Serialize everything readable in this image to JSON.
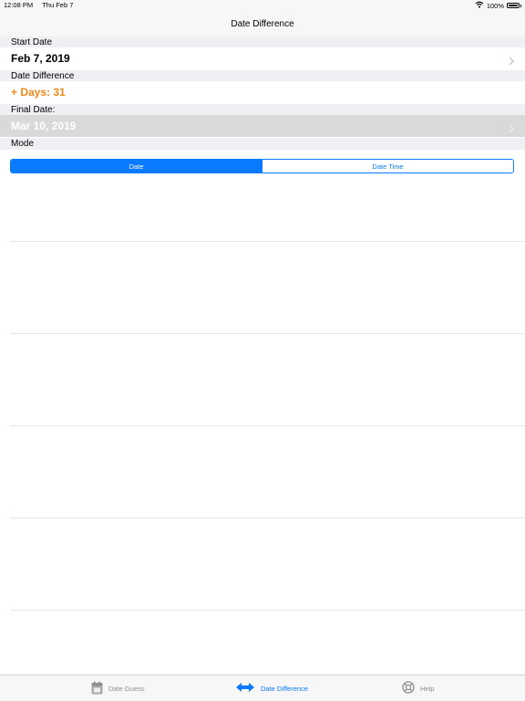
{
  "status_bar": {
    "time": "12:08 PM",
    "date": "Thu Feb 7",
    "battery": "100%",
    "icons": [
      "wifi-icon",
      "battery-icon"
    ]
  },
  "nav": {
    "title": "Date Difference"
  },
  "start": {
    "header": "Start Date",
    "value": "Feb 7, 2019"
  },
  "difference": {
    "header": "Date Difference",
    "value": "+ Days: 31"
  },
  "final": {
    "header": "Final Date:",
    "value": "Mar 10, 2019"
  },
  "mode": {
    "header": "Mode",
    "options": [
      "Date",
      "Date Time"
    ],
    "selected": "Date"
  },
  "tabs": [
    {
      "label": "Date Guess",
      "icon": "calendar-icon",
      "active": false
    },
    {
      "label": "Date Difference",
      "icon": "double-arrow-icon",
      "active": true
    },
    {
      "label": "Help",
      "icon": "lifebuoy-icon",
      "active": false
    }
  ],
  "colors": {
    "accent": "#0A7AFF",
    "orange": "#F08A18",
    "section_bg": "#EFEFF4",
    "disabled_row": "#D9D9D9"
  }
}
